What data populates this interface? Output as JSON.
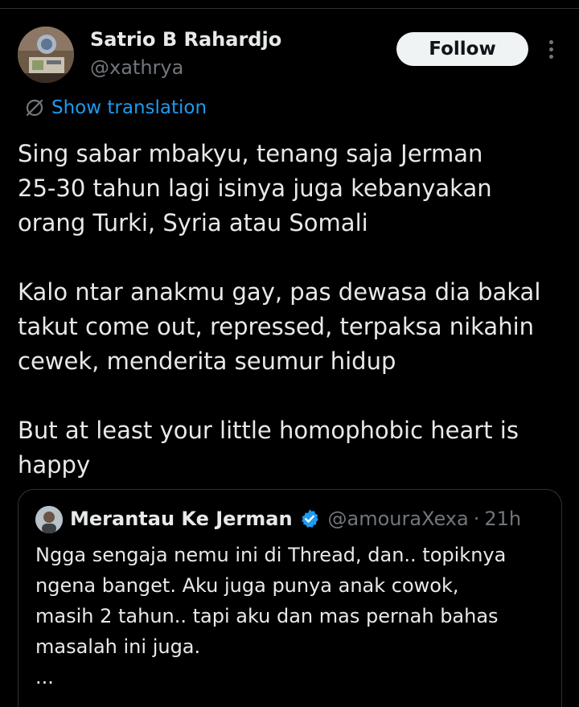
{
  "author": {
    "name": "Satrio B Rahardjo",
    "handle": "@xathrya",
    "follow_label": "Follow"
  },
  "translation_link": "Show translation",
  "tweet": {
    "paragraphs": [
      [
        "Sing sabar mbakyu, tenang saja Jerman",
        "25-30 tahun lagi isinya juga kebanyakan",
        "orang Turki, Syria atau Somali"
      ],
      [
        "Kalo ntar anakmu gay, pas dewasa dia bakal",
        "takut come out, repressed, terpaksa nikahin",
        "cewek, menderita seumur hidup"
      ],
      [
        "But at least your little homophobic heart is",
        "happy"
      ]
    ]
  },
  "quoted_tweet": {
    "name": "Merantau Ke Jerman",
    "handle": "@amouraXexa",
    "separator": "·",
    "time": "21h",
    "lines": [
      "Ngga sengaja nemu ini di Thread, dan.. topiknya",
      "ngena banget. Aku juga punya anak cowok,",
      "masih 2 tahun.. tapi aku dan mas pernah bahas",
      "masalah ini juga.",
      "..."
    ]
  },
  "colors": {
    "background": "#000000",
    "text": "#e7e9ea",
    "secondary_text": "#71767b",
    "link": "#1d9bf0",
    "border": "#2f3336",
    "follow_bg": "#eff3f4"
  },
  "icons": {
    "translate": "translate-icon",
    "more": "more-options-icon",
    "verified": "verified-badge-icon"
  }
}
